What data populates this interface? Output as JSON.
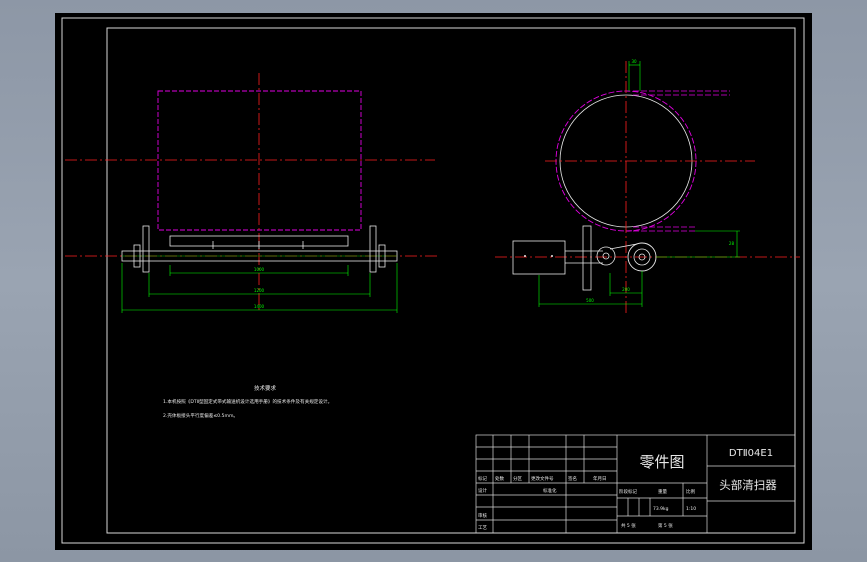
{
  "technical_requirements": {
    "heading": "技术要求",
    "item_1": "1.本机按照《DTⅡ型固定式带式输送机设计选用手册》的技术条件及有关规定设计。",
    "item_2": "2.壳体板接头平行度偏差≤0.5mm。"
  },
  "dimensions": {
    "d1": "1000",
    "d2": "1200",
    "d3": "1400",
    "d4": "500",
    "d5": "200",
    "d6": "28",
    "d7": "30"
  },
  "title_block": {
    "drawing_type": "零件图",
    "drawing_code": "DTⅡ04E1",
    "part_name": "头部清扫器",
    "mark_label": "标记",
    "count_label": "处数",
    "zone_label": "分区",
    "change_doc_label": "更改文件号",
    "signature_label": "签名",
    "date_label": "年月日",
    "design_label": "设计",
    "standardize_label": "标准化",
    "review_label": "审核",
    "process_label": "工艺",
    "stage_mark_label": "阶段标记",
    "weight_label": "重量",
    "scale_label": "比例",
    "weight_value": "73.9kg",
    "scale_value": "1:10",
    "total_sheets": "共 5 张",
    "sheet_no": "第 5 张"
  }
}
